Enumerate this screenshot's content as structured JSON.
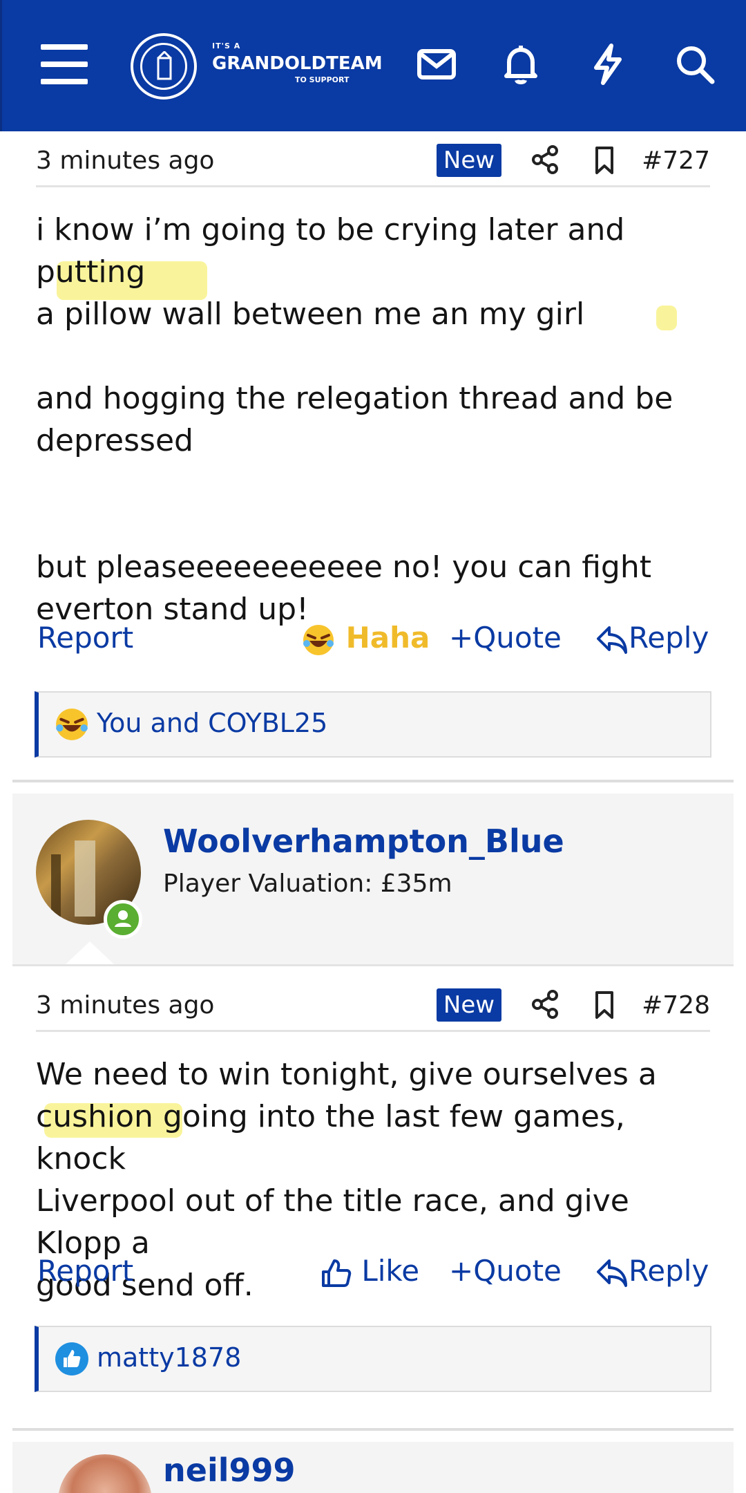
{
  "header": {
    "logo_small": "IT'S A",
    "logo_main": "GRANDOLDTEAM",
    "logo_sub": "TO SUPPORT",
    "accent": "#0a3aa3",
    "icons": [
      "menu-icon",
      "mail-icon",
      "bell-icon",
      "bolt-icon",
      "search-icon"
    ]
  },
  "posts": [
    {
      "time": "3 minutes ago",
      "badge": "New",
      "number": "#727",
      "lines": [
        "i know i’m going to be crying later and putting",
        "a pillow wall between me an my girl",
        "and hogging the relegation thread and be",
        "depressed",
        "but pleaseeeeeeeeeee no! you can fight",
        "everton stand up!"
      ],
      "actions": {
        "report": "Report",
        "reaction": "Haha",
        "quote": "Quote",
        "reply": "Reply"
      },
      "reactions_text": "You and COYBL25"
    },
    {
      "author": "Woolverhampton_Blue",
      "user_title": "Player Valuation: £35m",
      "time": "3 minutes ago",
      "badge": "New",
      "number": "#728",
      "lines": [
        "We need to win tonight, give ourselves a",
        "cushion going into the last few games, knock",
        "Liverpool out of the title race, and give Klopp a",
        "good send off."
      ],
      "actions": {
        "report": "Report",
        "reaction": "Like",
        "quote": "Quote",
        "reply": "Reply"
      },
      "reactions_text": "matty1878"
    },
    {
      "author": "neil999"
    }
  ]
}
